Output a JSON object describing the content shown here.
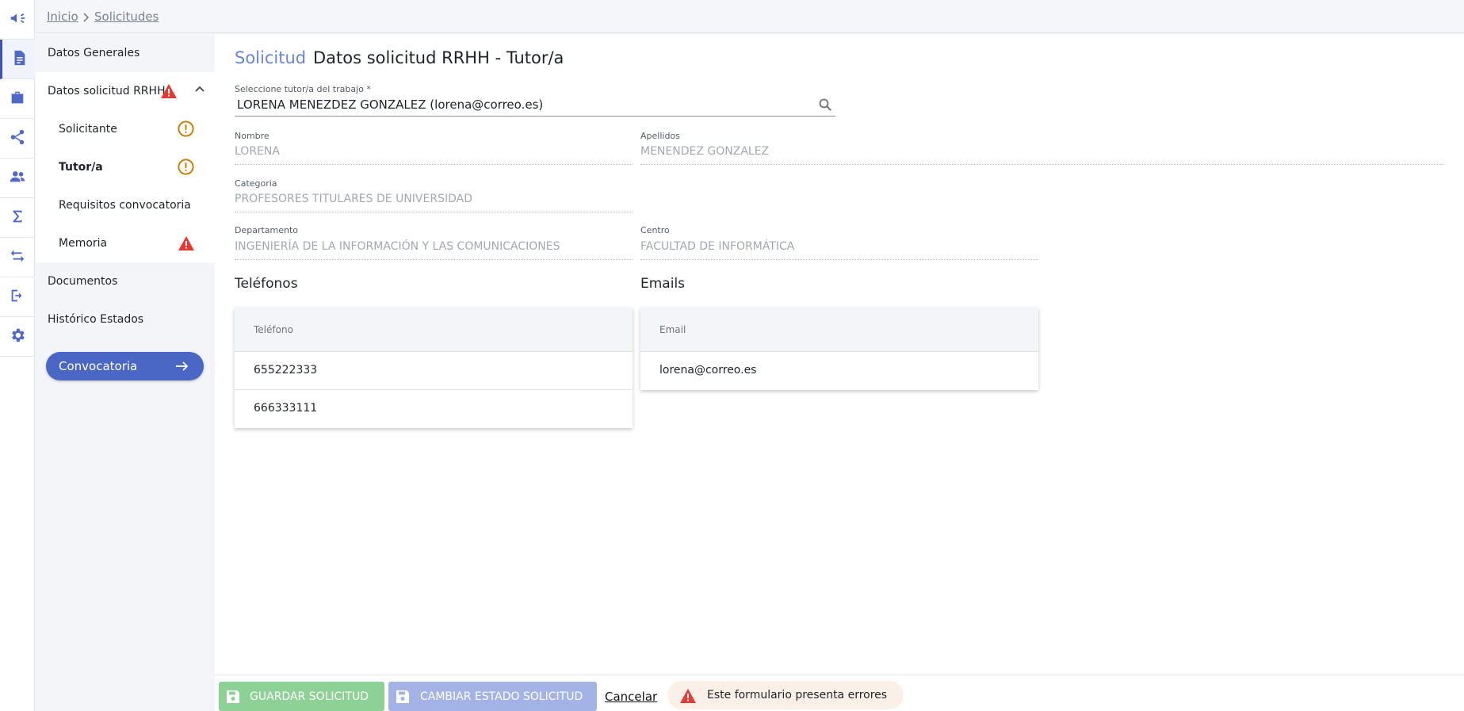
{
  "breadcrumb": {
    "home": "Inicio",
    "current": "Solicitudes"
  },
  "rail": [
    {
      "icon": "megaphone-icon"
    },
    {
      "icon": "document-icon",
      "active": true
    },
    {
      "icon": "briefcase-icon"
    },
    {
      "icon": "share-icon"
    },
    {
      "icon": "people-icon"
    },
    {
      "icon": "sigma-icon"
    },
    {
      "icon": "swap-icon"
    },
    {
      "icon": "logout-icon"
    },
    {
      "icon": "gear-icon"
    }
  ],
  "sidenav": {
    "items": [
      {
        "label": "Datos Generales"
      },
      {
        "label": "Datos solicitud RRHH",
        "status": "error",
        "expanded": true
      },
      {
        "label": "Documentos"
      },
      {
        "label": "Histórico Estados"
      }
    ],
    "subitems": [
      {
        "label": "Solicitante",
        "status": "warning"
      },
      {
        "label": "Tutor/a",
        "status": "warning",
        "active": true
      },
      {
        "label": "Requisitos convocatoria",
        "status": ""
      },
      {
        "label": "Memoria",
        "status": "error"
      }
    ],
    "convocatoria_button": "Convocatoria"
  },
  "page": {
    "title_prefix": "Solicitud",
    "title": "Datos solicitud RRHH - Tutor/a"
  },
  "form": {
    "tutor": {
      "label": "Seleccione tutor/a del trabajo *",
      "value": "LORENA MENEZDEZ GONZALEZ (lorena@correo.es)"
    },
    "nombre": {
      "label": "Nombre",
      "value": "LORENA"
    },
    "apellidos": {
      "label": "Apellidos",
      "value": "MENENDEZ GONZALEZ"
    },
    "categoria": {
      "label": "Categoria",
      "value": "PROFESORES TITULARES DE UNIVERSIDAD"
    },
    "departamento": {
      "label": "Departamento",
      "value": "INGENIERÍA DE LA INFORMACIÓN Y LAS COMUNICACIONES"
    },
    "centro": {
      "label": "Centro",
      "value": "FACULTAD DE INFORMÁTICA"
    }
  },
  "telefonos": {
    "heading": "Teléfonos",
    "column": "Teléfono",
    "rows": [
      "655222333",
      "666333111"
    ]
  },
  "emails": {
    "heading": "Emails",
    "column": "Email",
    "rows": [
      "lorena@correo.es"
    ]
  },
  "actions": {
    "save": "GUARDAR SOLICITUD",
    "change_state": "CAMBIAR ESTADO SOLICITUD",
    "cancel": "Cancelar",
    "error_message": "Este formulario presenta errores"
  },
  "colors": {
    "accent": "#4a67c6",
    "error": "#e53935",
    "warning": "#c67a00",
    "save": "#8ed196",
    "change": "#a4b3e6"
  }
}
